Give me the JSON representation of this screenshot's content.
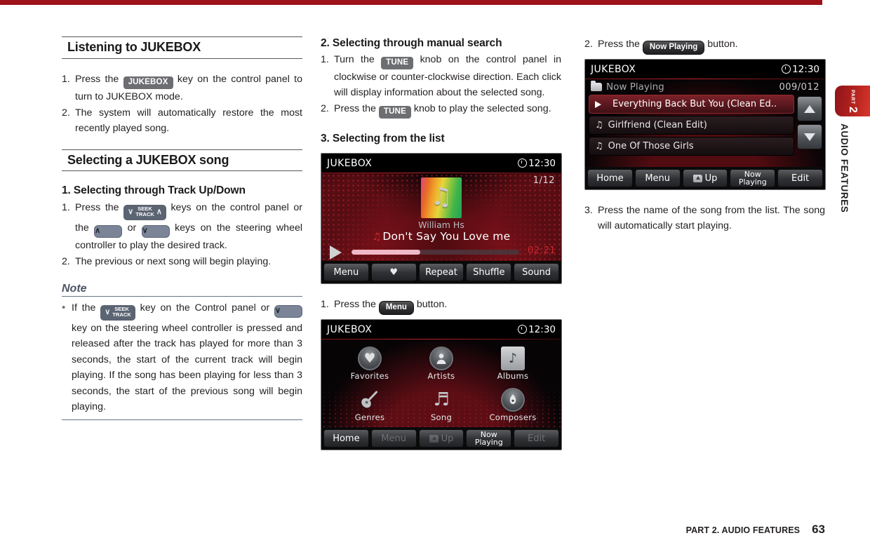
{
  "document": {
    "top_rule_color": "#9c131a",
    "side_tab": {
      "part_word": "PART",
      "part_number": "2",
      "section_label": "AUDIO FEATURES"
    },
    "footer": {
      "text": "PART 2. AUDIO FEATURES",
      "page_number": "63"
    }
  },
  "column_left": {
    "heading_1": "Listening to JUKEBOX",
    "steps_1": [
      {
        "marker": "1.",
        "pre": "Press the ",
        "chip": "JUKEBOX",
        "post": " key on the control panel to turn to JUKEBOX mode."
      },
      {
        "marker": "2.",
        "pre": "The system will automatically restore the most recently played song.",
        "chip": "",
        "post": ""
      }
    ],
    "heading_2": "Selecting a JUKEBOX song",
    "subheading_1": "1. Selecting through Track Up/Down",
    "steps_2": {
      "item1_marker": "1.",
      "item1_a": "Press the ",
      "item1_seek_down": "∨",
      "item1_seek_top": "SEEK",
      "item1_seek_bottom": "TRACK",
      "item1_seek_up": "∧",
      "item1_b": " keys on the control panel or the ",
      "item1_arrow_up": "∧",
      "item1_c": " or ",
      "item1_arrow_down": "∨",
      "item1_d": " keys on the steering wheel controller to play the desired track.",
      "item2_marker": "2.",
      "item2_text": "The previous or next song will begin playing."
    },
    "note_title": "Note",
    "note": {
      "bullet": "•",
      "a": "If the ",
      "seek_down": "∨",
      "seek_top": "SEEK",
      "seek_bottom": "TRACK",
      "b": " key on the Control panel or ",
      "arrow_down": "∨",
      "c": " key on the steering wheel controller is pressed and released after the track has played for more than 3 seconds, the start of the current track will begin playing. If the song has been playing for less than 3 seconds, the start of the previous song will begin playing."
    }
  },
  "column_middle": {
    "subheading_2": "2. Selecting through manual search",
    "steps": {
      "item1_marker": "1.",
      "item1_a": "Turn the ",
      "item1_chip": "TUNE",
      "item1_b": " knob on the control panel in clockwise or counter-clockwise direction. Each click will display information about the selected song.",
      "item2_marker": "2.",
      "item2_a": "Press the ",
      "item2_chip": "TUNE",
      "item2_b": " knob to play the selected song."
    },
    "subheading_3": "3. Selecting from the list",
    "caption_1": {
      "marker": "1.",
      "pre": "Press the ",
      "chip": "Menu",
      "post": " button."
    }
  },
  "column_right": {
    "caption_2": {
      "marker": "2.",
      "pre": "Press the ",
      "chip": "Now Playing",
      "post": " button."
    },
    "step_3": {
      "marker": "3.",
      "text": "Press the name of the song from the list. The song will automatically start playing."
    }
  },
  "screen_now_playing": {
    "title": "JUKEBOX",
    "clock": "12:30",
    "track_index": "1/12",
    "artist": "William Hs",
    "song": "Don't Say You Love me",
    "song_note_glyph": "♫",
    "elapsed_time": "02:21",
    "progress_percent": 41,
    "softkeys": [
      {
        "label": "Menu",
        "icon": "",
        "dim": false
      },
      {
        "label": "",
        "icon": "heart-icon",
        "dim": false
      },
      {
        "label": "Repeat",
        "icon": "",
        "dim": false
      },
      {
        "label": "Shuffle",
        "icon": "",
        "dim": false
      },
      {
        "label": "Sound",
        "icon": "",
        "dim": false
      }
    ]
  },
  "screen_menu_grid": {
    "title": "JUKEBOX",
    "clock": "12:30",
    "tiles": [
      {
        "label": "Favorites",
        "icon": "heart-icon",
        "style": "round",
        "glyph": "♥"
      },
      {
        "label": "Artists",
        "icon": "person-icon",
        "style": "round",
        "glyph": "👤"
      },
      {
        "label": "Albums",
        "icon": "music-note-icon",
        "style": "square",
        "glyph": "♪"
      },
      {
        "label": "Genres",
        "icon": "guitar-icon",
        "style": "plain",
        "glyph": "🎸"
      },
      {
        "label": "Song",
        "icon": "double-note-icon",
        "style": "plain",
        "glyph": "♬"
      },
      {
        "label": "Composers",
        "icon": "pen-nib-icon",
        "style": "round",
        "glyph": "✒"
      }
    ],
    "softkeys": [
      {
        "label": "Home",
        "dim": false,
        "icon": ""
      },
      {
        "label": "Menu",
        "dim": true,
        "icon": ""
      },
      {
        "label": "Up",
        "dim": true,
        "icon": "folder-up-icon"
      },
      {
        "label": "Now Playing",
        "dim": false,
        "icon": "",
        "two_line": true
      },
      {
        "label": "Edit",
        "dim": true,
        "icon": ""
      }
    ]
  },
  "screen_list": {
    "title": "JUKEBOX",
    "clock": "12:30",
    "breadcrumb": "Now Playing",
    "counter": "009/012",
    "rows": [
      {
        "label": "Everything Back But You (Clean Ed..",
        "selected": true,
        "glyph": "play-icon"
      },
      {
        "label": "Girlfriend (Clean Edit)",
        "selected": false,
        "glyph": "♫"
      },
      {
        "label": "One Of Those Girls",
        "selected": false,
        "glyph": "♫"
      }
    ],
    "scroll_up_label": "scroll-up",
    "scroll_down_label": "scroll-down",
    "softkeys": [
      {
        "label": "Home",
        "dim": false,
        "icon": ""
      },
      {
        "label": "Menu",
        "dim": false,
        "icon": ""
      },
      {
        "label": "Up",
        "dim": false,
        "icon": "folder-up-icon"
      },
      {
        "label": "Now Playing",
        "dim": false,
        "icon": "",
        "two_line": true
      },
      {
        "label": "Edit",
        "dim": false,
        "icon": ""
      }
    ]
  }
}
